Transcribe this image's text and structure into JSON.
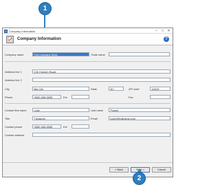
{
  "callouts": {
    "one": "1",
    "two": "2"
  },
  "window": {
    "title": "Company Information",
    "controls": {
      "min": "–",
      "max": "□",
      "close": "✕"
    }
  },
  "header": {
    "title": "Company Information",
    "help": "?"
  },
  "form": {
    "company_name": {
      "label": "Company name",
      "value": "Full Company Deck"
    },
    "trade_name": {
      "label": "Trade name",
      "value": ""
    },
    "address1": {
      "label": "Address line 1",
      "value": "100 Cheech Road"
    },
    "address2": {
      "label": "Address line 2",
      "value": ""
    },
    "city": {
      "label": "City",
      "value": "Big City"
    },
    "state": {
      "label": "State",
      "value": "NY"
    },
    "zip": {
      "label": "ZIP code",
      "value": "10010"
    },
    "phone": {
      "label": "Phone",
      "value": "(555) 555-5555"
    },
    "phone_ext": {
      "label": "Ext",
      "value": ""
    },
    "fax": {
      "label": "Fax",
      "value": ""
    },
    "contact_first": {
      "label": "Contact first name",
      "value": "Judy"
    },
    "last_name": {
      "label": "Last name",
      "value": "Powell"
    },
    "title": {
      "label": "Title",
      "value": "Treasurer"
    },
    "email": {
      "label": "Email",
      "value": "judy.f@fullcdeck.com"
    },
    "contact_phone": {
      "label": "Contact phone",
      "value": "(555) 555-5555"
    },
    "contact_ext": {
      "label": "Ext",
      "value": ""
    },
    "contact_address": {
      "label": "Contact address",
      "value": ""
    }
  },
  "buttons": {
    "back": "< Back",
    "next": "Next >",
    "cancel": "Cancel"
  }
}
